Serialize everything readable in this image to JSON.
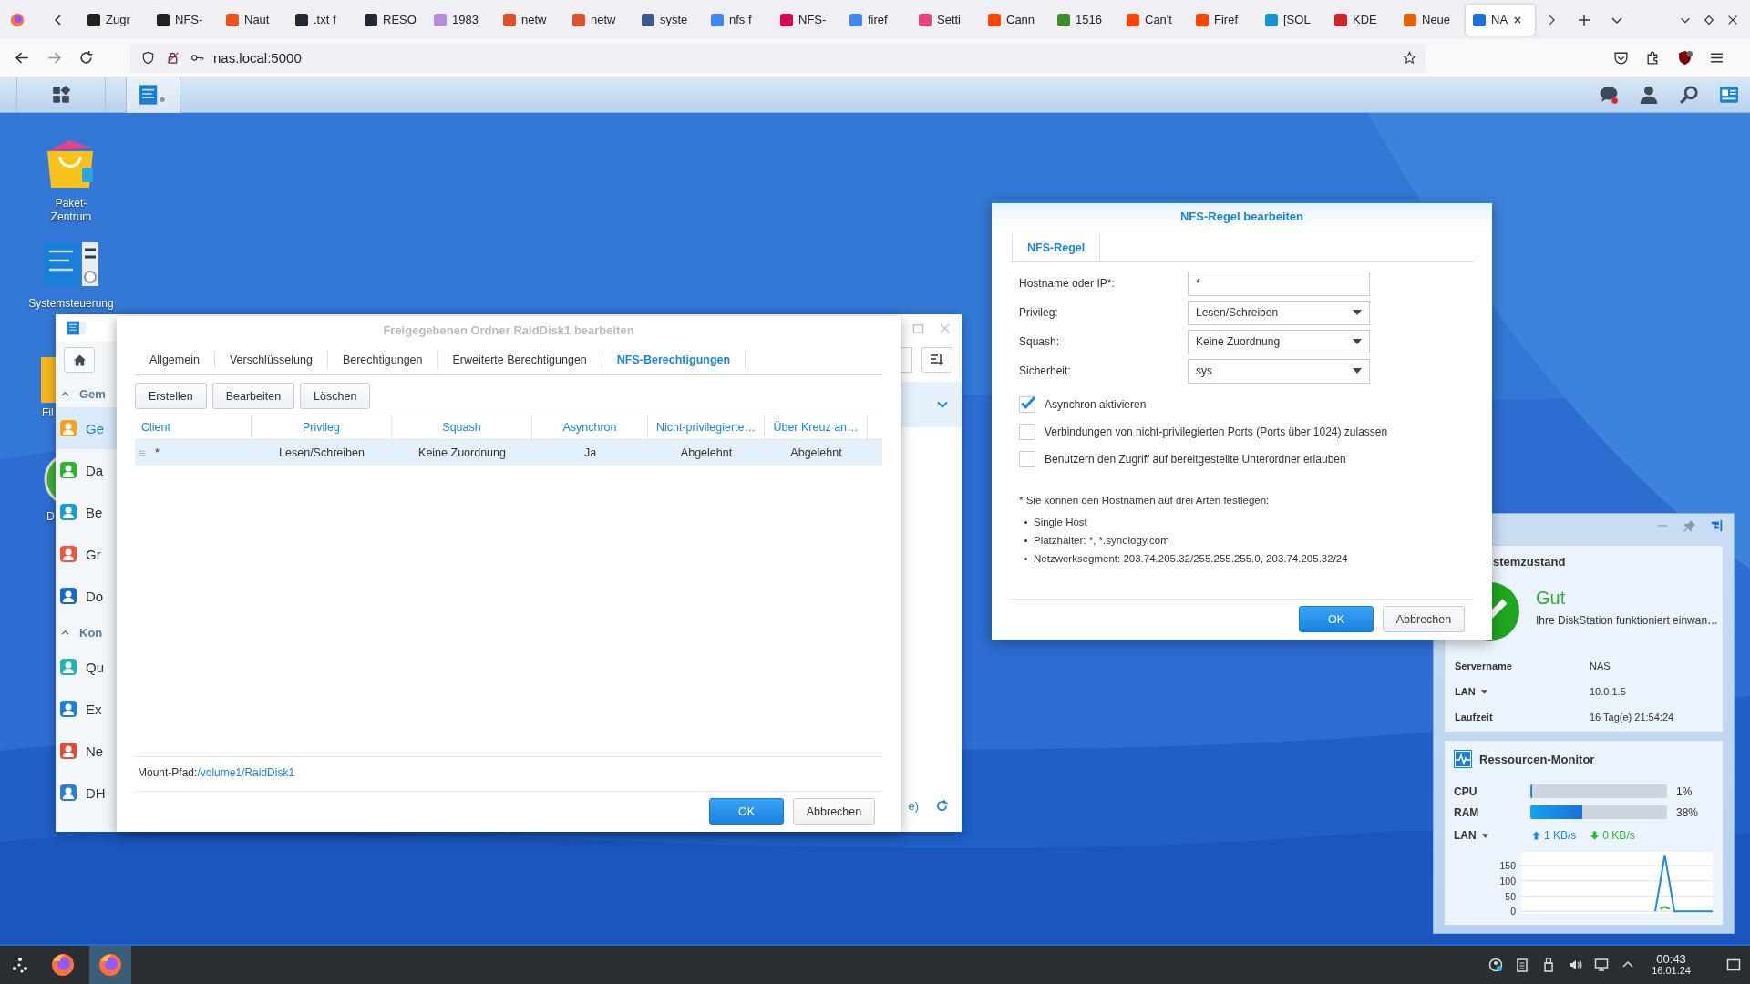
{
  "browser": {
    "tabs": [
      {
        "label": "Zugr",
        "selected": false,
        "color": "#222222"
      },
      {
        "label": "NFS-",
        "selected": false,
        "color": "#222222"
      },
      {
        "label": "Naut",
        "selected": false,
        "color": "#e95420"
      },
      {
        "label": ".txt f",
        "selected": false,
        "color": "#24292f"
      },
      {
        "label": "RESO",
        "selected": false,
        "color": "#24292f"
      },
      {
        "label": "1983",
        "selected": false,
        "color": "#b58adf"
      },
      {
        "label": "netw",
        "selected": false,
        "color": "#e0502b"
      },
      {
        "label": "netw",
        "selected": false,
        "color": "#e0502b"
      },
      {
        "label": "syste",
        "selected": false,
        "color": "#3b5b8f"
      },
      {
        "label": "nfs f",
        "selected": false,
        "color": "#4285f4"
      },
      {
        "label": "NFS-",
        "selected": false,
        "color": "#d70751"
      },
      {
        "label": "firef",
        "selected": false,
        "color": "#4285f4"
      },
      {
        "label": "Setti",
        "selected": false,
        "color": "#e5467f"
      },
      {
        "label": "Cann",
        "selected": false,
        "color": "#ff4500"
      },
      {
        "label": "1516",
        "selected": false,
        "color": "#3f8c2f"
      },
      {
        "label": "Can't",
        "selected": false,
        "color": "#ff4500"
      },
      {
        "label": "Firef",
        "selected": false,
        "color": "#ff4500"
      },
      {
        "label": "[SOL",
        "selected": false,
        "color": "#1793d1"
      },
      {
        "label": "KDE",
        "selected": false,
        "color": "#d0232a"
      },
      {
        "label": "Neue",
        "selected": false,
        "color": "#e66000"
      },
      {
        "label": "NA",
        "selected": true,
        "color": "#1e6fd9"
      }
    ],
    "url": "nas.local:5000"
  },
  "desktop_icons": [
    {
      "label": "Paket-Zentrum"
    },
    {
      "label": "Systemsteuerung"
    },
    {
      "label": "Fil"
    },
    {
      "label": "D"
    }
  ],
  "control_panel": {
    "sidebar": [
      {
        "kind": "section",
        "label": "Gem",
        "expanded": true
      },
      {
        "kind": "item",
        "label": "Ge",
        "selected": true,
        "color": "#f7a21b"
      },
      {
        "kind": "item",
        "label": "Da",
        "selected": false,
        "color": "#2db32d"
      },
      {
        "kind": "item",
        "label": "Be",
        "selected": false,
        "color": "#1aa0c8"
      },
      {
        "kind": "item",
        "label": "Gr",
        "selected": false,
        "color": "#e9573f"
      },
      {
        "kind": "item",
        "label": "Do",
        "selected": false,
        "color": "#1767c4"
      },
      {
        "kind": "section",
        "label": "Kon",
        "expanded": true
      },
      {
        "kind": "item",
        "label": "Qu",
        "selected": false,
        "color": "#1fb5b0"
      },
      {
        "kind": "item",
        "label": "Ex",
        "selected": false,
        "color": "#1d7fd6"
      },
      {
        "kind": "item",
        "label": "Ne",
        "selected": false,
        "color": "#e24d3b"
      },
      {
        "kind": "item",
        "label": "DH",
        "selected": false,
        "color": "#2a7fd4"
      }
    ],
    "footer_text": "e)"
  },
  "share_dialog": {
    "title": "Freigegebenen Ordner RaidDisk1 bearbeiten",
    "tabs": [
      {
        "label": "Allgemein",
        "selected": false
      },
      {
        "label": "Verschlüsselung",
        "selected": false
      },
      {
        "label": "Berechtigungen",
        "selected": false
      },
      {
        "label": "Erweiterte Berechtigungen",
        "selected": false
      },
      {
        "label": "NFS-Berechtigungen",
        "selected": true
      }
    ],
    "buttons": [
      "Erstellen",
      "Bearbeiten",
      "Löschen"
    ],
    "columns": [
      "Client",
      "Privileg",
      "Squash",
      "Asynchron",
      "Nicht-privilegierte…",
      "Über Kreuz an…"
    ],
    "rows": [
      {
        "selected": true,
        "cells": [
          "*",
          "Lesen/Schreiben",
          "Keine Zuordnung",
          "Ja",
          "Abgelehnt",
          "Abgelehnt"
        ]
      }
    ],
    "mount_label": "Mount-Pfad:",
    "mount_path": "/volume1/RaidDisk1",
    "ok": "OK",
    "cancel": "Abbrechen"
  },
  "nfs_dialog": {
    "title": "NFS-Regel bearbeiten",
    "tab": "NFS-Regel",
    "fields": [
      {
        "label": "Hostname oder IP*:",
        "kind": "text",
        "value": "*"
      },
      {
        "label": "Privileg:",
        "kind": "select",
        "value": "Lesen/Schreiben"
      },
      {
        "label": "Squash:",
        "kind": "select",
        "value": "Keine Zuordnung"
      },
      {
        "label": "Sicherheit:",
        "kind": "select",
        "value": "sys"
      }
    ],
    "checkboxes": [
      {
        "label": "Asynchron aktivieren",
        "checked": true
      },
      {
        "label": "Verbindungen von nicht-privilegierten Ports (Ports über 1024) zulassen",
        "checked": false
      },
      {
        "label": "Benutzern den Zugriff auf bereitgestellte Unterordner erlauben",
        "checked": false
      }
    ],
    "note": "* Sie können den Hostnamen auf drei Arten festlegen:",
    "bullets": [
      "Single Host",
      "Platzhalter: *, *.synology.com",
      "Netzwerksegment: 203.74.205.32/255.255.255.0, 203.74.205.32/24"
    ],
    "ok": "OK",
    "cancel": "Abbrechen"
  },
  "widgets": {
    "health": {
      "title": "stemzustand",
      "status": "Gut",
      "message": "Ihre DiskStation funktioniert einwan…",
      "rows": [
        {
          "label": "Servername",
          "value": "NAS",
          "dropdown": false
        },
        {
          "label": "LAN",
          "value": "10.0.1.5",
          "dropdown": true
        },
        {
          "label": "Laufzeit",
          "value": "16 Tag(e) 21:54:24",
          "dropdown": false
        }
      ]
    },
    "monitor": {
      "title": "Ressourcen-Monitor",
      "meters": [
        {
          "label": "CPU",
          "level": 0.01,
          "reading": "1%"
        },
        {
          "label": "RAM",
          "level": 0.38,
          "reading": "38%"
        }
      ],
      "lan_label": "LAN",
      "upload": "1 KB/s",
      "download": "0 KB/s",
      "chart_data": {
        "type": "line",
        "ylim": [
          -8,
          195
        ],
        "yticks": [
          0,
          50,
          100,
          150
        ],
        "grid": true,
        "series": [
          {
            "color": "#1e88e5",
            "values": [
              null,
              null,
              null,
              null,
              null,
              null,
              null,
              null,
              null,
              null,
              null,
              null,
              null,
              null,
              null,
              null,
              null,
              null,
              null,
              null,
              null,
              null,
              null,
              null,
              null,
              null,
              null,
              null,
              0,
              92,
              185,
              92,
              0,
              0,
              0,
              0,
              0,
              0,
              0,
              0,
              0
            ]
          },
          {
            "color": "#2eb82e",
            "values": [
              null,
              null,
              null,
              null,
              null,
              null,
              null,
              null,
              null,
              null,
              null,
              null,
              null,
              null,
              null,
              null,
              null,
              null,
              null,
              null,
              null,
              null,
              null,
              null,
              null,
              null,
              null,
              null,
              null,
              8,
              15,
              8,
              null,
              null,
              null,
              null,
              null,
              null,
              null,
              null,
              null
            ]
          }
        ]
      }
    }
  },
  "taskbar": {
    "apps": [
      {
        "selected": false
      },
      {
        "selected": true
      }
    ],
    "time": "00:43",
    "date": "16.01.24"
  }
}
